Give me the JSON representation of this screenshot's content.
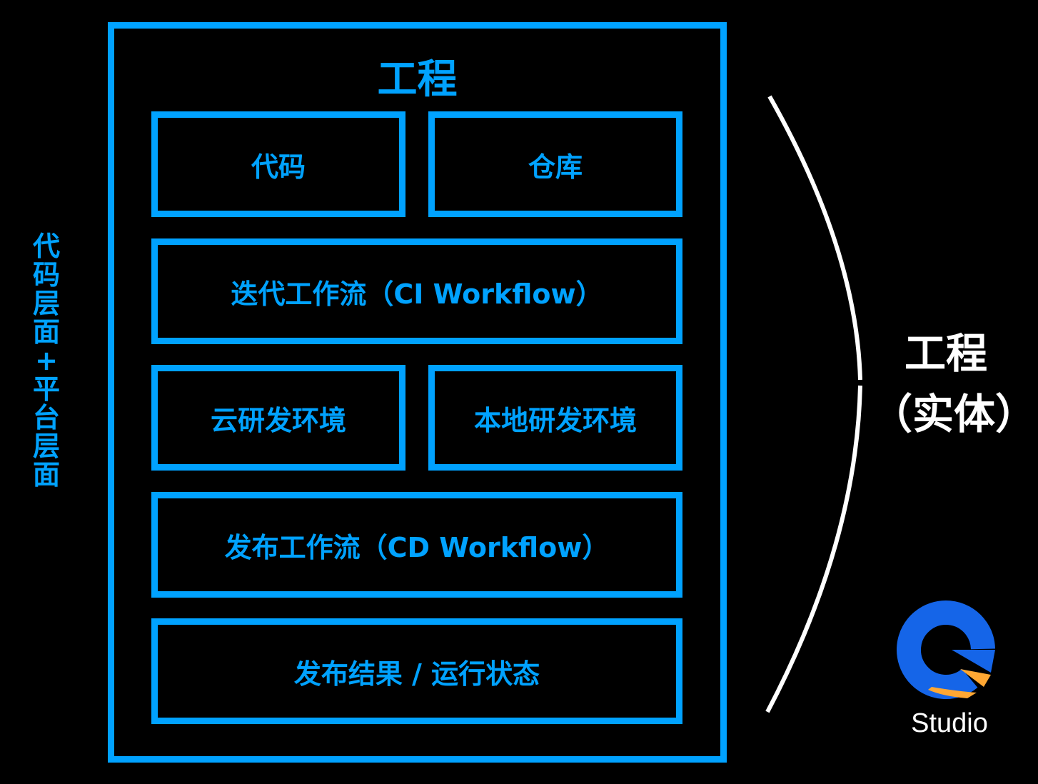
{
  "title": "工程",
  "side_label": "代码层面 + 平台层面",
  "boxes": {
    "code": "代码",
    "repo": "仓库",
    "ci": "迭代工作流（CI Workflow）",
    "cloud_env": "云研发环境",
    "local_env": "本地研发环境",
    "cd": "发布工作流（CD Workflow）",
    "result": "发布结果 / 运行状态"
  },
  "right_label": {
    "line1": "工程",
    "line2": "（实体）"
  },
  "logo": {
    "text": "Studio",
    "icon": "g-studio-logo-icon"
  },
  "colors": {
    "accent": "#00a2ff",
    "background": "#000000",
    "logo_blue": "#1565e8",
    "logo_orange": "#ffa733"
  }
}
